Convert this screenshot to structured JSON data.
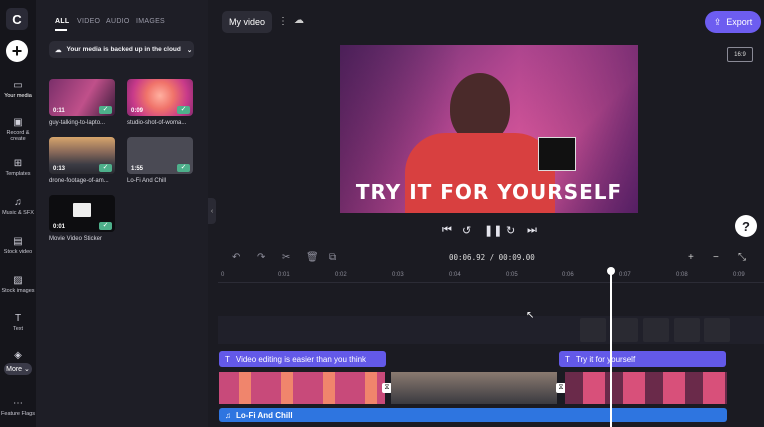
{
  "app": {
    "logo_letter": "C"
  },
  "rail": {
    "items": [
      {
        "label": "Your media",
        "icon": "folder-icon"
      },
      {
        "label": "Record & create",
        "icon": "camera-icon"
      },
      {
        "label": "Templates",
        "icon": "templates-icon"
      },
      {
        "label": "Music & SFX",
        "icon": "music-icon"
      },
      {
        "label": "Stock video",
        "icon": "film-icon"
      },
      {
        "label": "Stock images",
        "icon": "image-icon"
      },
      {
        "label": "Text",
        "icon": "text-icon"
      },
      {
        "label": "Graphics",
        "icon": "shapes-icon"
      }
    ],
    "more_label": "More",
    "feature_flags_label": "Feature Flags"
  },
  "media_panel": {
    "tabs": [
      "ALL",
      "VIDEO",
      "AUDIO",
      "IMAGES"
    ],
    "backup_text": "Your media is backed up in the cloud",
    "items": [
      {
        "duration": "0:11",
        "label": "guy-talking-to-lapto..."
      },
      {
        "duration": "0:09",
        "label": "studio-shot-of-woma..."
      },
      {
        "duration": "0:13",
        "label": "drone-footage-of-am..."
      },
      {
        "duration": "1:55",
        "label": "Lo-Fi And Chill"
      },
      {
        "duration": "0:01",
        "label": "Movie Video Sticker"
      }
    ]
  },
  "header": {
    "project_title": "My video",
    "export_label": "Export",
    "aspect_ratio": "16:9"
  },
  "preview": {
    "overlay_text": "TRY IT FOR YOURSELF"
  },
  "playback": {
    "current_time": "00:06.92",
    "total_time": "00:09.00",
    "separator": " / "
  },
  "timeline": {
    "ruler_ticks": [
      "0",
      "0:01",
      "0:02",
      "0:03",
      "0:04",
      "0:05",
      "0:06",
      "0:07",
      "0:08",
      "0:09"
    ],
    "text_clips": [
      "Video editing is easier than you think",
      "Try it for yourself"
    ],
    "audio_clip": "Lo-Fi And Chill"
  },
  "help_label": "?",
  "colors": {
    "accent": "#6d5df0",
    "text_clip": "#6359e8",
    "audio_clip": "#2e75e0",
    "check": "#4eb08b"
  }
}
